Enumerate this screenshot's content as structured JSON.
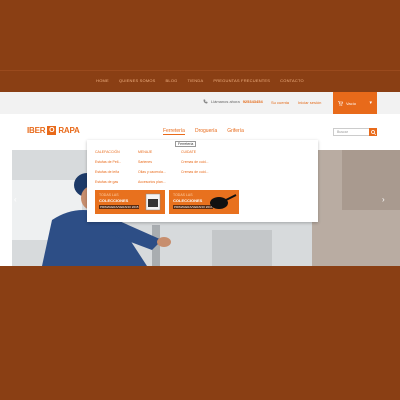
{
  "topnav": [
    "HOME",
    "QUIENES SOMOS",
    "BLOG",
    "TIENDA",
    "PREGUNTAS FRECUENTES",
    "CONTACTO"
  ],
  "infobar": {
    "phone_label": "Llámanos ahora",
    "phone_number": "925343454",
    "account": "Su cuenta",
    "login": "Iniciar sesión",
    "cart": "Vacío"
  },
  "logo": {
    "left": "IBER",
    "mark": "O",
    "right": "RAPA"
  },
  "categories": [
    "Ferretería",
    "Droguería",
    "Grifería"
  ],
  "search": {
    "placeholder": "Buscar"
  },
  "tooltip": "Ferretería",
  "mega": {
    "col1": {
      "heading": "CALEFACCIÓN",
      "items": [
        "Estufas de Pell...",
        "Estufas de leña",
        "Estufas de gas"
      ]
    },
    "col2": {
      "heading": "MENAJE",
      "items": [
        "Sartenes",
        "Ollas y cacerola...",
        "Accesorios plan..."
      ]
    },
    "col3": {
      "heading": "CUIDATE",
      "items": [
        "Cremas de cuid...",
        "Cremas de cuid..."
      ]
    },
    "banners": [
      {
        "l1": "TODAS LAS",
        "l2": "COLECCIONES",
        "l3": "PRIMAVERA/VERANO 2015"
      },
      {
        "l1": "TODAS LAS",
        "l2": "COLECCIONES",
        "l3": "PRIMAVERA/VERANO 2015"
      }
    ]
  },
  "colors": {
    "brown": "#8a3f14",
    "orange": "#e86a1a"
  }
}
